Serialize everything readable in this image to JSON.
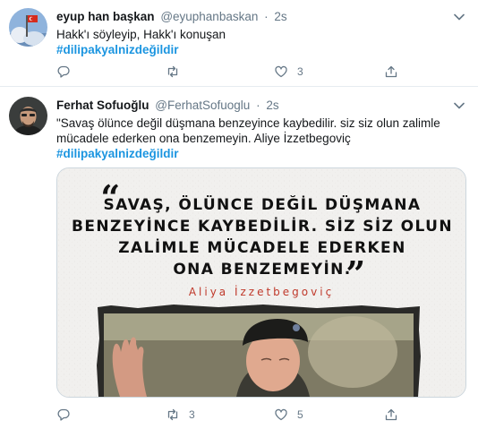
{
  "tweets": [
    {
      "author": {
        "name": "eyup han başkan",
        "handle": "@eyuphanbaskan"
      },
      "separator": "·",
      "time": "2s",
      "text": "Hakk'ı söyleyip, Hakk'ı konuşan",
      "hashtag": "#dilipakyalnizdeğildir",
      "counts": {
        "reply": "",
        "retweet": "",
        "like": "3",
        "share": ""
      }
    },
    {
      "author": {
        "name": "Ferhat Sofuoğlu",
        "handle": "@FerhatSofuoglu"
      },
      "separator": "·",
      "time": "2s",
      "text": "\"Savaş ölünce değil düşmana benzeyince kaybedilir. siz siz olun zalimle mücadele ederken ona benzemeyin. Aliye İzzetbegoviç",
      "hashtag": "#dilipakyalnizdeğildir",
      "media": {
        "quote_lines": [
          "SAVAŞ, ÖLÜNCE DEĞİL DÜŞMANA",
          "BENZEYİNCE KAYBEDİLİR. SİZ SİZ OLUN",
          "ZALİMLE MÜCADELE EDERKEN",
          "ONA BENZEMEYİN."
        ],
        "open_quote": "“",
        "close_quote": "”",
        "attribution": "Aliya İzzetbegoviç",
        "attribution_color": "#c0392b"
      },
      "counts": {
        "reply": "",
        "retweet": "3",
        "like": "5",
        "share": ""
      }
    }
  ],
  "icons": {
    "caret": "chevron-down-icon",
    "reply": "reply-icon",
    "retweet": "retweet-icon",
    "like": "heart-icon",
    "share": "share-icon"
  },
  "colors": {
    "link": "#1b95e0",
    "muted": "#657786",
    "text": "#14171a",
    "border": "#e6ecf0"
  }
}
